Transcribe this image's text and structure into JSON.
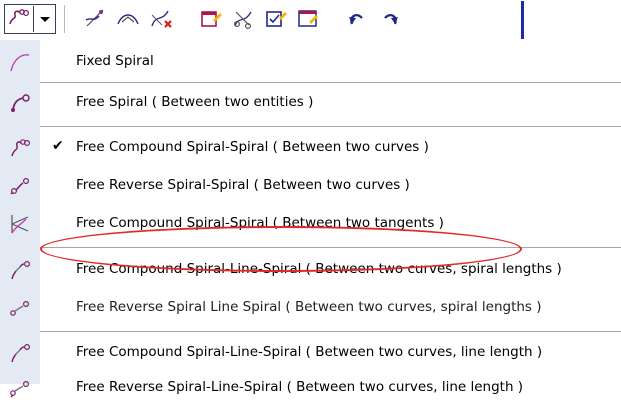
{
  "toolbar": {
    "dropdown_icon": "spiral-curve-icon",
    "buttons": [
      {
        "icon": "spiral-tangent-icon"
      },
      {
        "icon": "spiral-arc-icon"
      },
      {
        "icon": "delete-spiral-icon"
      },
      {
        "icon": "edit-entity-icon"
      },
      {
        "icon": "cut-entity-icon"
      },
      {
        "icon": "checked-edit-icon"
      },
      {
        "icon": "window-edit-icon"
      },
      {
        "icon": "undo-icon"
      },
      {
        "icon": "redo-icon"
      }
    ]
  },
  "menu": {
    "items": [
      {
        "label": "Fixed Spiral",
        "icon": "fixed-spiral-icon",
        "checked": false
      },
      {
        "label": "Free Spiral ( Between two entities )",
        "icon": "free-spiral-icon",
        "checked": false
      },
      {
        "label": "Free Compound Spiral-Spiral ( Between two curves )",
        "icon": "compound-spiral-icon",
        "checked": true
      },
      {
        "label": "Free Reverse Spiral-Spiral ( Between two curves )",
        "icon": "reverse-spiral-icon",
        "checked": false
      },
      {
        "label": "Free Compound Spiral-Spiral ( Between two tangents )",
        "icon": "compound-tangent-spiral-icon",
        "checked": false
      },
      {
        "label": "Free Compound Spiral-Line-Spiral ( Between two curves, spiral lengths )",
        "icon": "compound-line-spiral-icon",
        "checked": false
      },
      {
        "label": "Free Reverse Spiral Line Spiral ( Between two curves, spiral lengths )",
        "icon": "reverse-line-spiral-icon",
        "checked": false
      },
      {
        "label": "Free Compound Spiral-Line-Spiral ( Between two curves, line length )",
        "icon": "compound-line-length-icon",
        "checked": false
      },
      {
        "label": "Free Reverse Spiral-Line-Spiral ( Between two curves, line length )",
        "icon": "reverse-line-length-icon",
        "checked": false
      }
    ],
    "check_glyph": "✔"
  },
  "colors": {
    "accent_red": "#e02a2a",
    "menu_gutter": "#e4eaf3",
    "toolbar_bar": "#1f2aa3"
  }
}
